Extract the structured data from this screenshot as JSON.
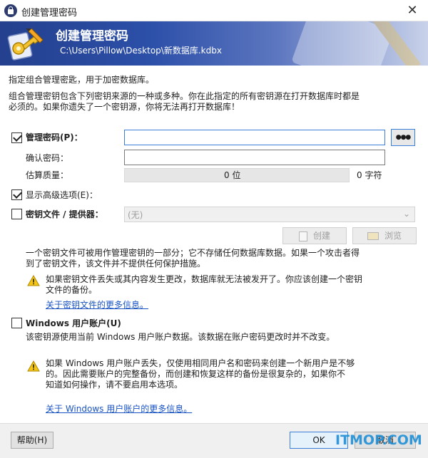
{
  "window": {
    "title": "创建管理密码",
    "close_glyph": "✕"
  },
  "banner": {
    "title": "创建管理密码",
    "path": "C:\\Users\\Pillow\\Desktop\\新数据库.kdbx"
  },
  "intro": {
    "line1": "指定组合管理密匙，用于加密数据库。",
    "line2": "组合管理密钥包含下列密钥来源的一种或多种。你在此指定的所有密钥源在打开数据库时都是",
    "line3": "必须的。如果你遗失了一个密钥源，你将无法再打开数据库！"
  },
  "master_password": {
    "label": "管理密码(P)：",
    "checked": true,
    "value": "",
    "reveal_label": "●●●",
    "confirm_label": "确认密码：",
    "confirm_value": "",
    "quality_label": "估算质量：",
    "quality_bits": "0 位",
    "quality_chars": "0 字符",
    "quality_fraction": 0
  },
  "advanced": {
    "label": "显示高级选项(E)：",
    "checked": true
  },
  "key_file": {
    "label": "密钥文件 / 提供器：",
    "checked": false,
    "select_value": "(无)",
    "create_label": "创建",
    "browse_label": "浏览",
    "desc1": "一个密钥文件可被用作管理密钥的一部分；它不存储任何数据库数据。如果一个攻击者得",
    "desc2": "到了密钥文件，该文件并不提供任何保护措施。",
    "warn1": "如果密钥文件丢失或其内容发生更改，数据库就无法被发开了。你应该创建一个密钥",
    "warn2": "文件的备份。",
    "link": "关于密钥文件的更多信息。"
  },
  "windows_account": {
    "label": "Windows 用户账户(U)",
    "checked": false,
    "desc": "该密钥源使用当前 Windows 用户账户数据。该数据在账户密码更改时并不改变。",
    "warn1": "如果 Windows 用户账户丢失，仅使用相同用户名和密码来创建一个新用户是不够",
    "warn2": "的。因此需要账户的完整备份，而创建和恢复这样的备份是很复杂的，如果你不",
    "warn3": "知道如何操作，请不要启用本选项。",
    "link": "关于 Windows 用户账户的更多信息。"
  },
  "footer": {
    "help_label": "帮助(H)",
    "ok_label": "OK",
    "cancel_label": "取消"
  },
  "watermark": "ITMOP.COM",
  "colors": {
    "accent": "#2c4fa8",
    "link": "#1a54c4",
    "focus": "#3c7fd9"
  }
}
